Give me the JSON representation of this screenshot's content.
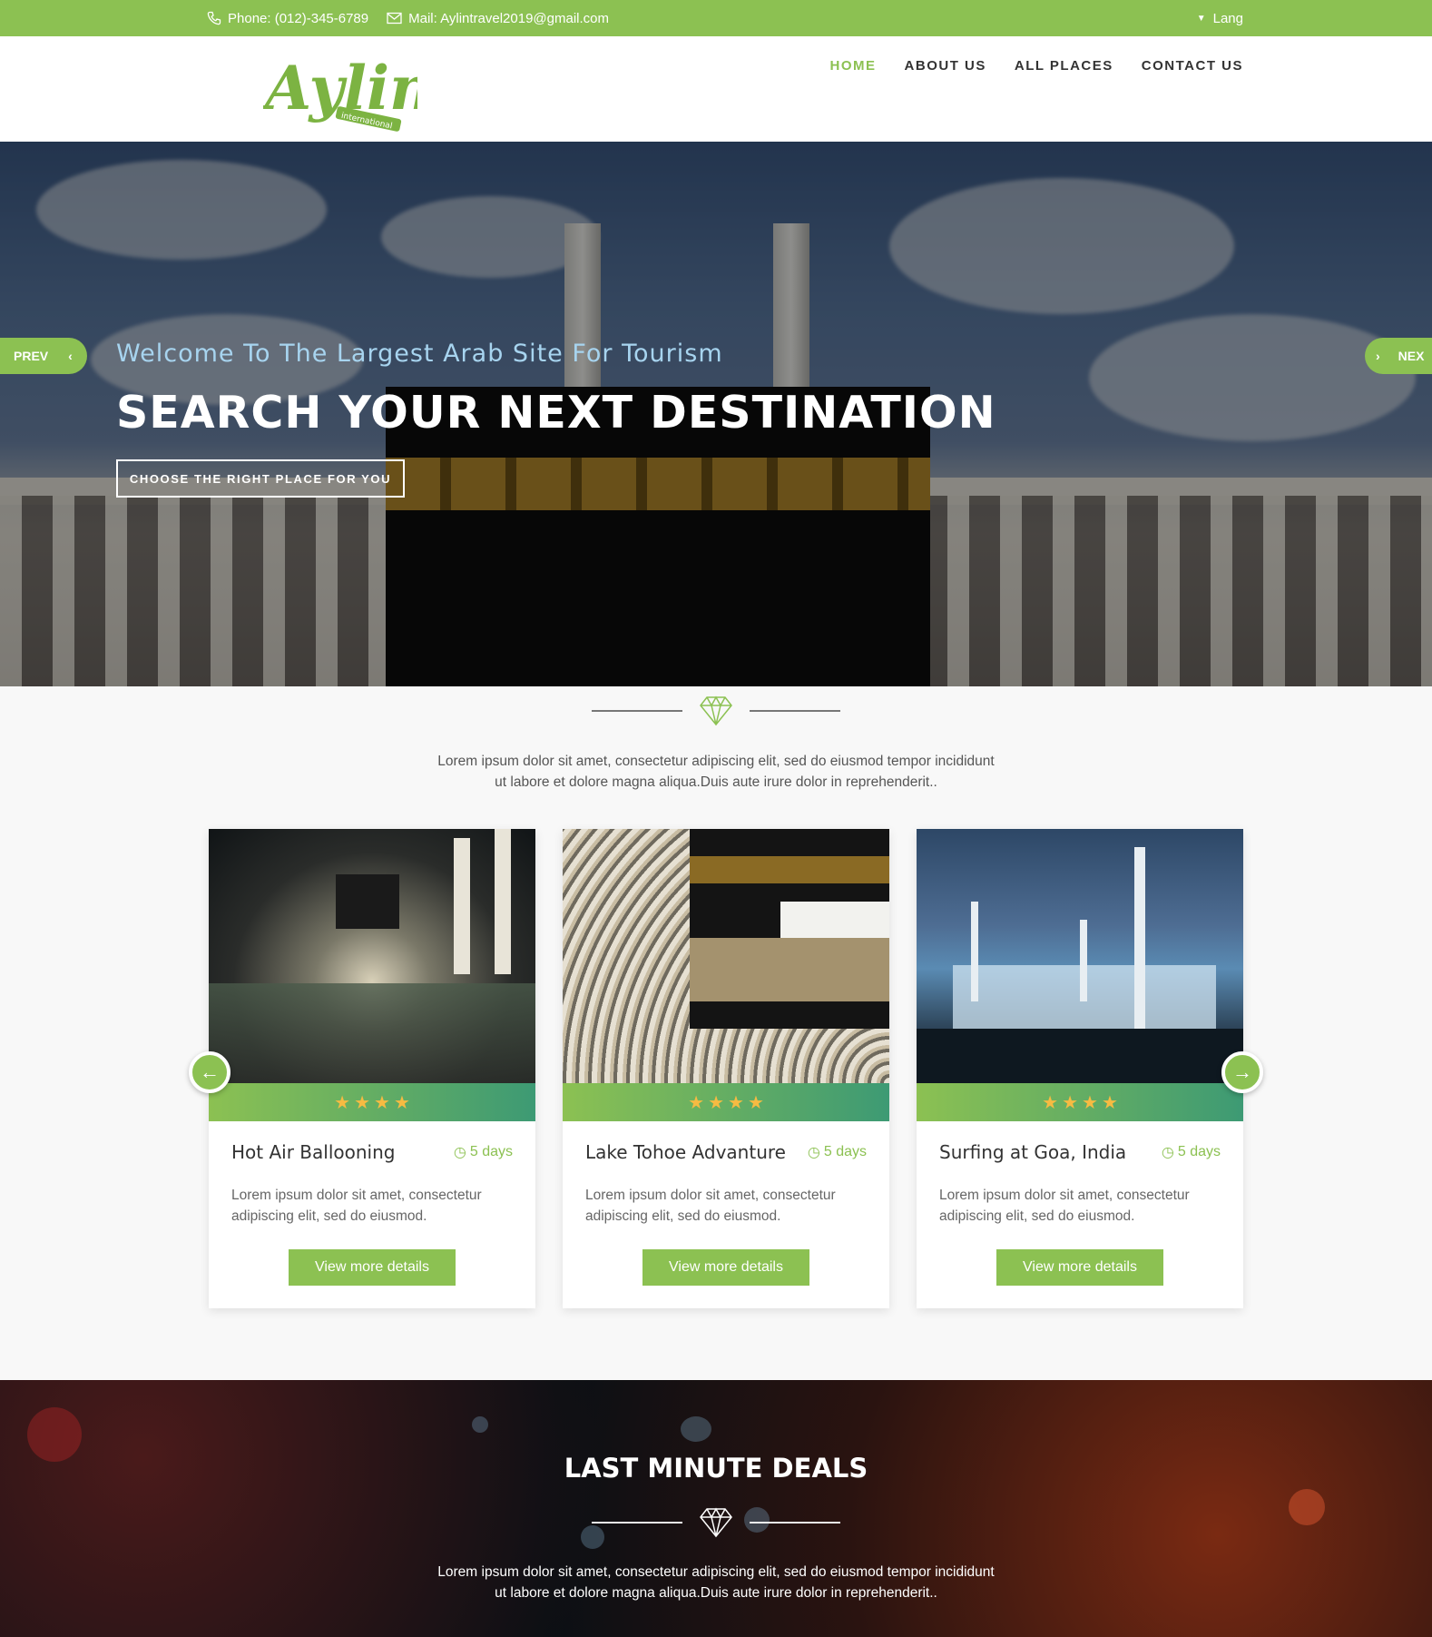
{
  "topbar": {
    "phone": "Phone: (012)-345-6789",
    "mail": "Mail: Aylintravel2019@gmail.com",
    "lang": "Lang"
  },
  "brand": {
    "name": "Aylin",
    "tagline": "international"
  },
  "nav": [
    {
      "label": "HOME",
      "active": true
    },
    {
      "label": "ABOUT US",
      "active": false
    },
    {
      "label": "ALL PLACES",
      "active": false
    },
    {
      "label": "CONTACT US",
      "active": false
    }
  ],
  "hero": {
    "welcome": "Welcome To The Largest Arab Site For Tourism",
    "headline": "SEARCH YOUR NEXT DESTINATION",
    "cta": "CHOOSE THE RIGHT PLACE FOR YOU",
    "prev": "PREV",
    "next": "NEX"
  },
  "intro": {
    "line1": "Lorem ipsum dolor sit amet, consectetur adipiscing elit, sed do eiusmod tempor incididunt",
    "line2": "ut labore et dolore magna aliqua.Duis aute irure dolor in reprehenderit.."
  },
  "cards": [
    {
      "title": "Hot Air Ballooning",
      "days": "5 days",
      "rating": 4,
      "desc1": "Lorem ipsum dolor sit amet, consectetur",
      "desc2": "adipiscing elit, sed do eiusmod.",
      "button": "View more details"
    },
    {
      "title": "Lake Tohoe Advanture",
      "days": "5 days",
      "rating": 4,
      "desc1": "Lorem ipsum dolor sit amet, consectetur",
      "desc2": "adipiscing elit, sed do eiusmod.",
      "button": "View more details"
    },
    {
      "title": "Surfing at Goa, India",
      "days": "5 days",
      "rating": 4,
      "desc1": "Lorem ipsum dolor sit amet, consectetur",
      "desc2": "adipiscing elit, sed do eiusmod.",
      "button": "View more details"
    }
  ],
  "deals": {
    "heading": "LAST MINUTE DEALS",
    "line1": "Lorem ipsum dolor sit amet, consectetur adipiscing elit, sed do eiusmod tempor incididunt",
    "line2": "ut labore et dolore magna aliqua.Duis aute irure dolor in reprehenderit.."
  },
  "colors": {
    "accent": "#8cc152",
    "star": "#f6bb42",
    "gradient_end": "#3d9a74"
  },
  "icons": [
    "phone-icon",
    "mail-icon",
    "caret-down-icon",
    "diamond-icon",
    "clock-icon",
    "star-icon",
    "arrow-left-icon",
    "arrow-right-icon",
    "chevron-left-icon",
    "chevron-right-icon"
  ]
}
